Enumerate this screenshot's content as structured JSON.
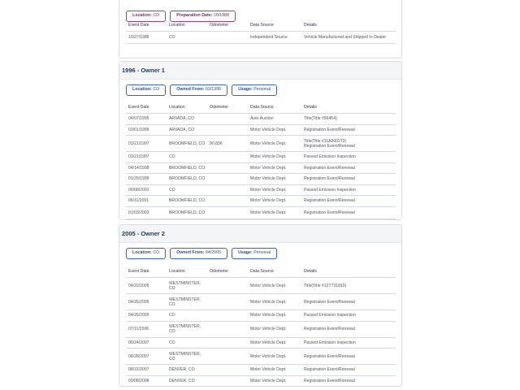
{
  "columns": [
    "Event Date",
    "Location",
    "Odometer",
    "Data Source",
    "Details"
  ],
  "cards": [
    {
      "top": 0,
      "title": "",
      "chips": [
        {
          "label": "Location:",
          "value": "CO",
          "color": "purple"
        },
        {
          "label": "Preparation Date:",
          "value": "10/1988",
          "color": "purple"
        }
      ],
      "rows": [
        [
          "10/27/1988",
          "CO",
          "",
          "Independent Source",
          "Vehicle Manufactured and Shipped to Dealer"
        ]
      ]
    },
    {
      "title": "1996 - Owner   1",
      "chips": [
        {
          "label": "Location:",
          "value": "CO",
          "color": "blue"
        },
        {
          "label": "Owned From:",
          "value": "03/1996",
          "color": "blue"
        },
        {
          "label": "Usage:",
          "value": "Personal",
          "color": "blue"
        }
      ],
      "rows": [
        [
          "04/07/1995",
          "ARVADA, CO",
          "",
          "Auto Auction",
          "Title(Title #96454)"
        ],
        [
          "03/01/1996",
          "ARVADA, CO",
          "",
          "Motor Vehicle Dept.",
          "Registration Event/Renewal"
        ],
        [
          "03/21/1997",
          "BROOMFIELD, CO",
          "90,836",
          "Motor Vehicle Dept.",
          "Title(Title #11A300273)\nRegistration Event/Renewal"
        ],
        [
          "03/21/1997",
          "CO",
          "",
          "Motor Vehicle Dept.",
          "Passed Emission Inspection"
        ],
        [
          "04/14/1998",
          "BROOMFIELD, CO",
          "",
          "Motor Vehicle Dept.",
          "Registration Event/Renewal"
        ],
        [
          "01/29/1999",
          "BROOMFIELD, CO",
          "",
          "Motor Vehicle Dept.",
          "Registration Event/Renewal"
        ],
        [
          "06/08/2001",
          "CO",
          "",
          "Motor Vehicle Dept.",
          "Passed Emission Inspection"
        ],
        [
          "06/11/2001",
          "BROOMFIELD, CO",
          "",
          "Motor Vehicle Dept.",
          "Registration Event/Renewal"
        ],
        [
          "01/03/2003",
          "BROOMFIELD, CO",
          "",
          "Motor Vehicle Dept.",
          "Registration Event/Renewal"
        ]
      ]
    },
    {
      "title": "2005 - Owner   2",
      "chips": [
        {
          "label": "Location:",
          "value": "CO",
          "color": "blue"
        },
        {
          "label": "Owned From:",
          "value": "04/2005",
          "color": "blue"
        },
        {
          "label": "Usage:",
          "value": "Personal",
          "color": "blue"
        }
      ],
      "rows": [
        [
          "04/22/2005",
          "WESTMINSTER,\nCO",
          "",
          "Motor Vehicle Dept.",
          "Title(Title #12T731810)"
        ],
        [
          "04/25/2005",
          "WESTMINSTER,\nCO",
          "",
          "Motor Vehicle Dept.",
          "Registration Event/Renewal"
        ],
        [
          "04/25/2005",
          "CO",
          "",
          "Motor Vehicle Dept.",
          "Passed Emission Inspection"
        ],
        [
          "07/11/2006",
          "WESTMINSTER,\nCO",
          "",
          "Motor Vehicle Dept.",
          "Registration Event/Renewal"
        ],
        [
          "06/24/2007",
          "CO",
          "",
          "Motor Vehicle Dept.",
          "Passed Emission Inspection"
        ],
        [
          "08/28/2007",
          "WESTMINSTER,\nCO",
          "",
          "Motor Vehicle Dept.",
          "Registration Event/Renewal"
        ],
        [
          "08/31/2007",
          "DENVER, CO",
          "",
          "Motor Vehicle Dept.",
          "Registration Event/Renewal"
        ],
        [
          "09/08/2008",
          "DENVER, CO",
          "",
          "Motor Vehicle Dept.",
          "Registration Event/Renewal"
        ]
      ]
    }
  ]
}
